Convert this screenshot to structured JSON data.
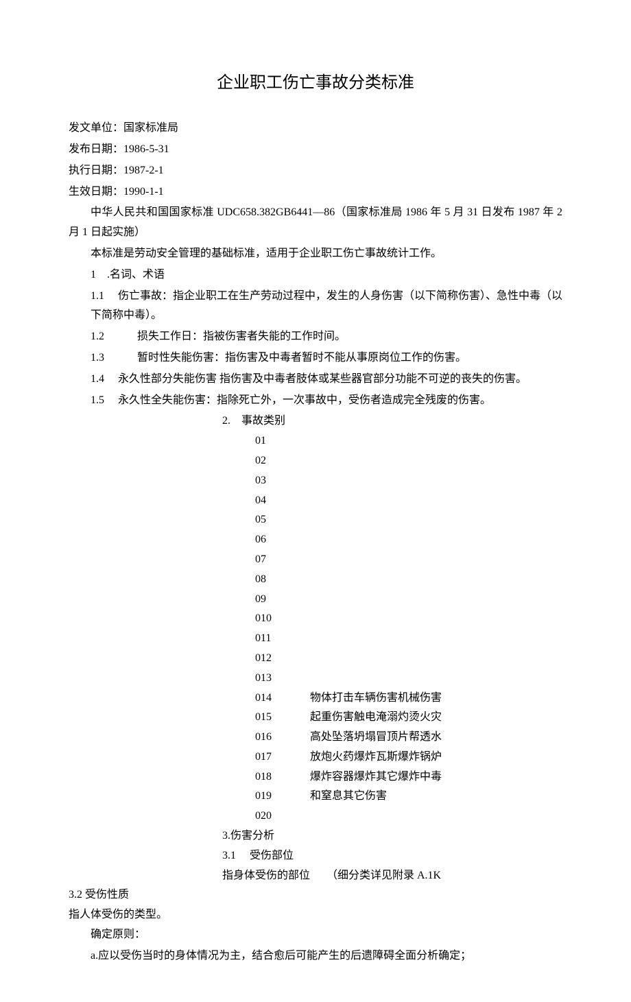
{
  "title": "企业职工伤亡事故分类标准",
  "meta": {
    "issuer_label": "发文单位：",
    "issuer": "国家标准局",
    "publish_label": "发布日期：",
    "publish_date": "1986-5-31",
    "exec_label": "执行日期：",
    "exec_date": "1987-2-1",
    "effective_label": "生效日期：",
    "effective_date": "1990-1-1"
  },
  "intro1": "中华人民共和国国家标准 UDC658.382GB6441—86（国家标准局 1986 年 5 月 31 日发布 1987 年 2 月 1 日起实施）",
  "intro2": "本标准是劳动安全管理的基础标准，适用于企业职工伤亡事故统计工作。",
  "sec1": {
    "header": "1　.名词、术语",
    "item1": "1.1　 伤亡事故：指企业职工在生产劳动过程中，发生的人身伤害（以下简称伤害）、急性中毒（以下简称中毒）。",
    "item2": "1.2　　　损失工作日：指被伤害者失能的工作时间。",
    "item3": "1.3　　　暂时性失能伤害：指伤害及中毒者暂时不能从事原岗位工作的伤害。",
    "item4": "1.4　 永久性部分失能伤害  指伤害及中毒者肢体或某些器官部分功能不可逆的丧失的伤害。",
    "item5": "1.5　 永久性全失能伤害：指除死亡外，一次事故中，受伤者造成完全残废的伤害。"
  },
  "sec2": {
    "header": "2.　事故类别",
    "nums": [
      "01",
      "02",
      "03",
      "04",
      "05",
      "06",
      "07",
      "08",
      "09",
      "010",
      "011",
      "012",
      "013",
      "014",
      "015",
      "016",
      "017",
      "018",
      "019",
      "020"
    ],
    "desc": "物体打击车辆伤害机械伤害起重伤害触电淹溺灼烫火灾高处坠落坍塌冒顶片帮透水放炮火药爆炸瓦斯爆炸锅炉爆炸容器爆炸其它爆炸中毒和窒息其它伤害"
  },
  "sec3": {
    "header": "3.伤害分析",
    "sub1": "3.1　 受伤部位",
    "sub1_text": "指身体受伤的部位　　（细分类详见附录 A.1K",
    "sub2": "3.2 受伤性质",
    "sub2_text": "指人体受伤的类型。",
    "principle_label": "确定原则：",
    "principle_a": "a.应以受伤当时的身体情况为主，结合愈后可能产生的后遗障碍全面分析确定；"
  }
}
